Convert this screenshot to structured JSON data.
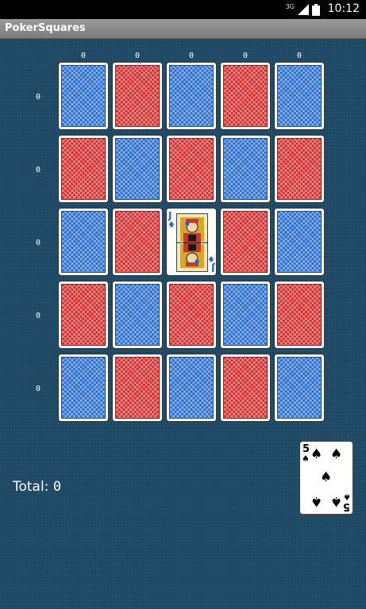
{
  "status_bar": {
    "network_label": "3G",
    "time": "10:12"
  },
  "app": {
    "title": "PokerSquares"
  },
  "scores": {
    "columns": [
      "0",
      "0",
      "0",
      "0",
      "0"
    ],
    "rows": [
      "0",
      "0",
      "0",
      "0",
      "0"
    ]
  },
  "grid": {
    "cells": [
      [
        "blue-back",
        "red-back",
        "blue-back",
        "red-back",
        "blue-back"
      ],
      [
        "red-back",
        "blue-back",
        "red-back",
        "blue-back",
        "red-back"
      ],
      [
        "blue-back",
        "red-back",
        "jack-of-diamonds",
        "red-back",
        "blue-back"
      ],
      [
        "red-back",
        "blue-back",
        "red-back",
        "blue-back",
        "red-back"
      ],
      [
        "blue-back",
        "red-back",
        "blue-back",
        "red-back",
        "blue-back"
      ]
    ],
    "placed_card": {
      "rank": "J",
      "suit_symbol": "♦",
      "suit_color": "#2266cc"
    }
  },
  "total": {
    "label": "Total:",
    "value": "0"
  },
  "next_card": {
    "rank": "5",
    "suit_symbol": "♠",
    "suit_color": "#000000"
  },
  "colors": {
    "table": "#1f4a66",
    "blue_back": "#2c6fcf",
    "red_back": "#d63030",
    "title_bar": "#8a8a8a"
  }
}
